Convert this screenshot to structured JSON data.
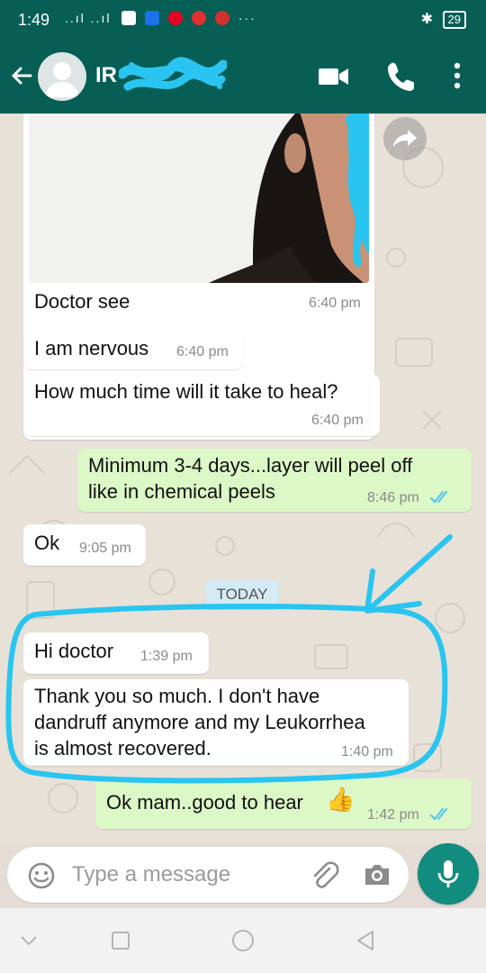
{
  "status_bar": {
    "time": "1:49",
    "signal_text": "..ıl ..ıl",
    "more": "···",
    "battery": "29"
  },
  "contact": {
    "name": "IR"
  },
  "messages": [
    {
      "direction": "in",
      "text": "Doctor see",
      "time": "6:40 pm",
      "has_photo": true
    },
    {
      "direction": "in",
      "text": "I am nervous",
      "time": "6:40 pm"
    },
    {
      "direction": "in",
      "text": "How much time will it take to heal?",
      "time": "6:40 pm"
    },
    {
      "direction": "out",
      "text": "Minimum 3-4 days...layer will peel off\nlike in chemical peels",
      "time": "8:46 pm",
      "status": "read"
    },
    {
      "direction": "in",
      "text": "Ok",
      "time": "9:05 pm"
    },
    {
      "direction": "in",
      "text": "Hi doctor",
      "time": "1:39 pm"
    },
    {
      "direction": "in",
      "text": "Thank you so much. I don't have\ndandruff anymore and my Leukorrhea\nis almost recovered.",
      "time": "1:40 pm"
    },
    {
      "direction": "out",
      "text": "Ok mam..good to hear",
      "time": "1:42 pm",
      "status": "read",
      "emoji": "👍"
    }
  ],
  "date_divider": "TODAY",
  "composer": {
    "placeholder": "Type a message"
  },
  "colors": {
    "header": "#075e54",
    "outgoing_bubble": "#dcf8c6",
    "incoming_bubble": "#ffffff",
    "read_ticks": "#4fc3f7",
    "annotation": "#29c5f0",
    "mic_button": "#128c7e"
  },
  "icons": [
    "back-arrow-icon",
    "video-call-icon",
    "voice-call-icon",
    "more-vert-icon",
    "forward-icon",
    "emoji-icon",
    "attach-icon",
    "camera-icon",
    "mic-icon",
    "nav-back-icon",
    "nav-home-icon",
    "nav-recents-icon",
    "nav-down-icon"
  ]
}
